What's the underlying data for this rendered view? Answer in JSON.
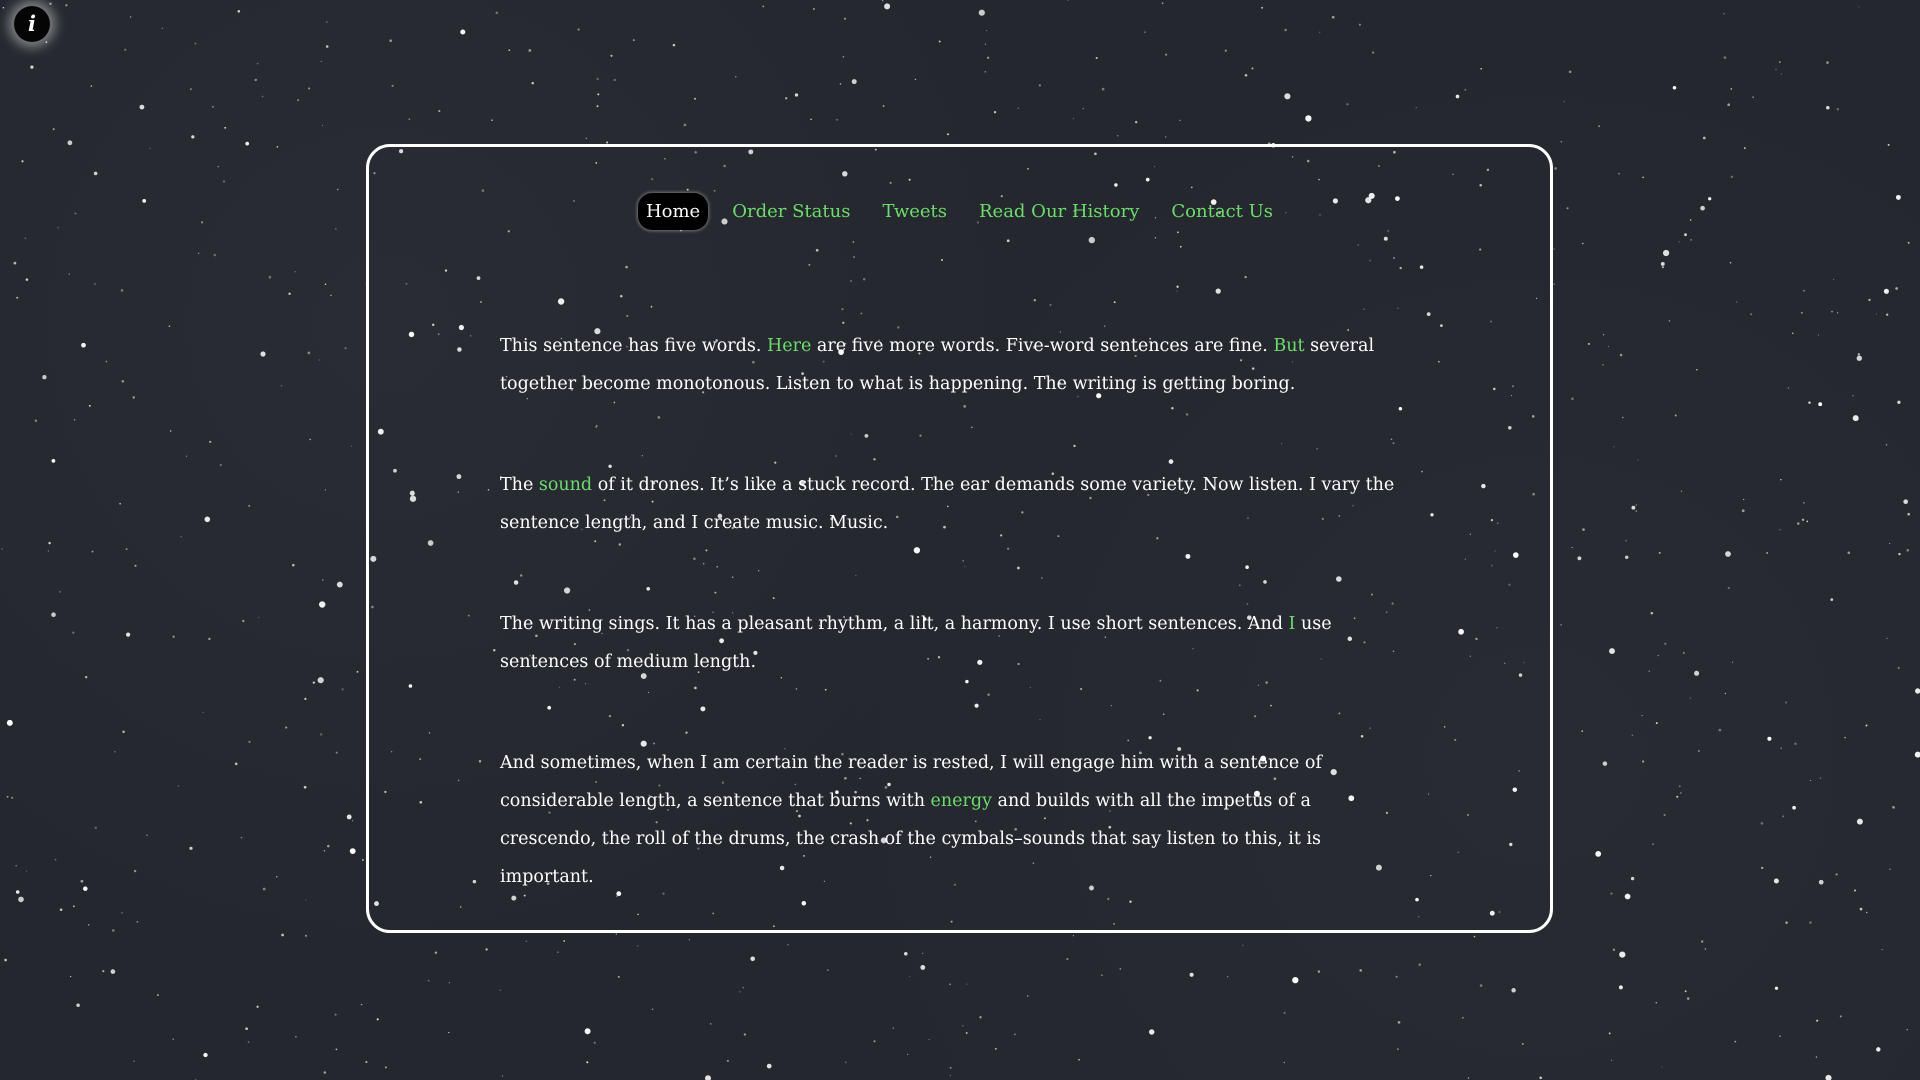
{
  "info_button": {
    "label": "i",
    "icon": "info-icon"
  },
  "colors": {
    "background": "#24272e",
    "accent": "#6ddc6d",
    "text": "#ffffff",
    "panel_border": "#ffffff"
  },
  "nav": {
    "items": [
      {
        "label": "Home",
        "active": true
      },
      {
        "label": "Order Status",
        "active": false
      },
      {
        "label": "Tweets",
        "active": false
      },
      {
        "label": "Read Our History",
        "active": false
      },
      {
        "label": "Contact Us",
        "active": false
      }
    ]
  },
  "paragraphs": [
    {
      "segments": [
        {
          "text": "This sentence has five words. "
        },
        {
          "text": "Here",
          "highlight": true
        },
        {
          "text": " are five more words. Five-word sentences are fine. "
        },
        {
          "text": "But",
          "highlight": true
        },
        {
          "text": " several together become monotonous. Listen to what is happening. The writing is getting boring."
        }
      ]
    },
    {
      "segments": [
        {
          "text": "The "
        },
        {
          "text": "sound",
          "highlight": true
        },
        {
          "text": " of it drones. It’s like a stuck record. The ear demands some variety. Now listen. I vary the sentence length, and I create music. Music."
        }
      ]
    },
    {
      "segments": [
        {
          "text": "The writing sings. It has a pleasant rhythm, a lilt, a harmony. I use short sentences. And "
        },
        {
          "text": "I",
          "highlight": true
        },
        {
          "text": " use sentences of medium length."
        }
      ]
    },
    {
      "segments": [
        {
          "text": "And sometimes, when I am certain the reader is rested, I will engage him with a sentence of considerable length, a sentence that burns with "
        },
        {
          "text": "energy",
          "highlight": true
        },
        {
          "text": " and builds with all the impetus of a crescendo, the roll of the drums, the crash of the cymbals–sounds that say listen to this, it is important."
        }
      ]
    }
  ]
}
